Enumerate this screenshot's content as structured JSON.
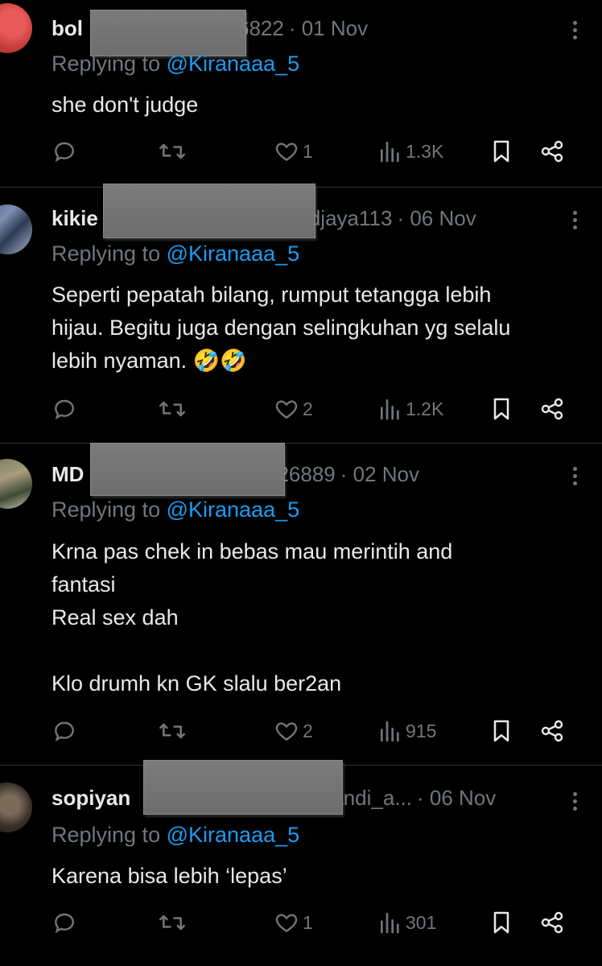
{
  "tweets": [
    {
      "name": "bol",
      "handle_suffix": "6822",
      "date": "· 01 Nov",
      "replying_label": "Replying to",
      "replying_to": "@Kiranaaa_5",
      "text": "she don't judge",
      "likes": "1",
      "views": "1.3K"
    },
    {
      "name": "kikie",
      "handle_suffix": "djaya113",
      "date": "· 06 Nov",
      "replying_label": "Replying to",
      "replying_to": "@Kiranaaa_5",
      "text": "Seperti pepatah bilang, rumput tetangga lebih\nhijau. Begitu juga dengan selingkuhan yg selalu\nlebih nyaman. 🤣🤣",
      "likes": "2",
      "views": "1.2K"
    },
    {
      "name": "MD",
      "handle_suffix": "26889",
      "date": "· 02 Nov",
      "replying_label": "Replying to",
      "replying_to": "@Kiranaaa_5",
      "text": "Krna pas chek in bebas mau merintih and\nfantasi\nReal sex dah\n\nKlo drumh kn GK slalu ber2an",
      "likes": "2",
      "views": "915"
    },
    {
      "name": "sopiyan",
      "handle_suffix": "andi_a...",
      "date": "· 06 Nov",
      "replying_label": "Replying to",
      "replying_to": "@Kiranaaa_5",
      "text": "Karena bisa lebih ‘lepas’",
      "likes": "1",
      "views": "301"
    }
  ],
  "colors": {
    "background": "#000000",
    "text": "#e7e9ea",
    "muted": "#71767b",
    "link": "#1d9bf0",
    "divider": "#2f3336",
    "redaction": "#757575"
  },
  "icons": [
    "reply-icon",
    "retweet-icon",
    "like-icon",
    "views-icon",
    "bookmark-icon",
    "share-icon",
    "more-icon"
  ]
}
